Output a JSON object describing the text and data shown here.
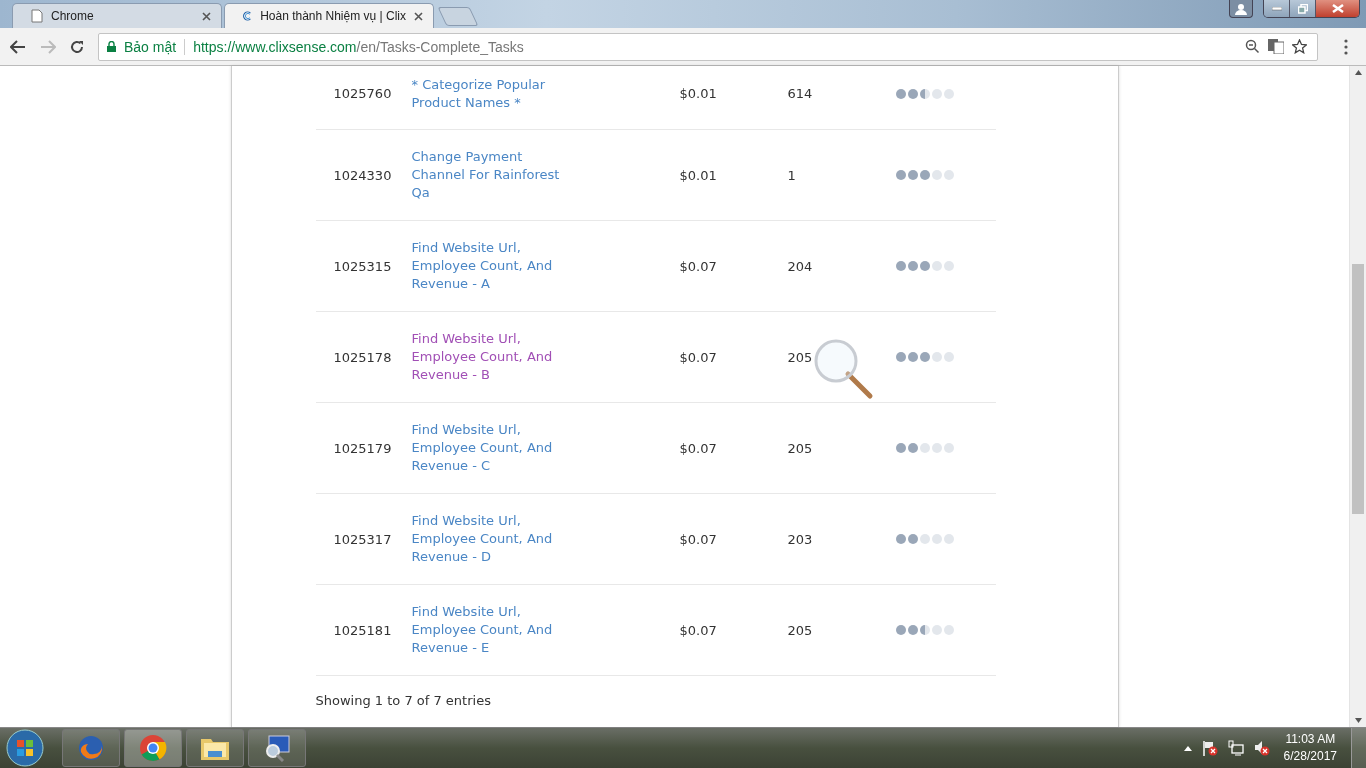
{
  "tabs": [
    {
      "title": "Chrome",
      "selected": false,
      "kind": "page"
    },
    {
      "title": "Hoàn thành Nhiệm vụ | Clix",
      "selected": true,
      "kind": "site"
    }
  ],
  "address_bar": {
    "security_label": "Bảo mật",
    "url_host": "https://www.clixsense.com",
    "url_path": "/en/Tasks-Complete_Tasks"
  },
  "table": {
    "rows": [
      {
        "id": "1025760",
        "name": "* Categorize Popular Product Names *",
        "visited": false,
        "price": "$0.01",
        "count": "614",
        "stars": 2.5
      },
      {
        "id": "1024330",
        "name": "Change Payment Channel For Rainforest Qa",
        "visited": false,
        "price": "$0.01",
        "count": "1",
        "stars": 3
      },
      {
        "id": "1025315",
        "name": "Find Website Url, Employee Count, And Revenue - A",
        "visited": false,
        "price": "$0.07",
        "count": "204",
        "stars": 3
      },
      {
        "id": "1025178",
        "name": "Find Website Url, Employee Count, And Revenue - B",
        "visited": true,
        "price": "$0.07",
        "count": "205",
        "stars": 3
      },
      {
        "id": "1025179",
        "name": "Find Website Url, Employee Count, And Revenue - C",
        "visited": false,
        "price": "$0.07",
        "count": "205",
        "stars": 2
      },
      {
        "id": "1025317",
        "name": "Find Website Url, Employee Count, And Revenue - D",
        "visited": false,
        "price": "$0.07",
        "count": "203",
        "stars": 2
      },
      {
        "id": "1025181",
        "name": "Find Website Url, Employee Count, And Revenue - E",
        "visited": false,
        "price": "$0.07",
        "count": "205",
        "stars": 2.5
      }
    ],
    "footer": "Showing 1 to 7 of 7 entries"
  },
  "taskbar": {
    "apps": [
      {
        "kind": "firefox",
        "selected": false
      },
      {
        "kind": "chrome",
        "selected": true
      },
      {
        "kind": "folder",
        "selected": false
      },
      {
        "kind": "viewer",
        "selected": false
      }
    ],
    "time": "11:03 AM",
    "date": "6/28/2017"
  }
}
